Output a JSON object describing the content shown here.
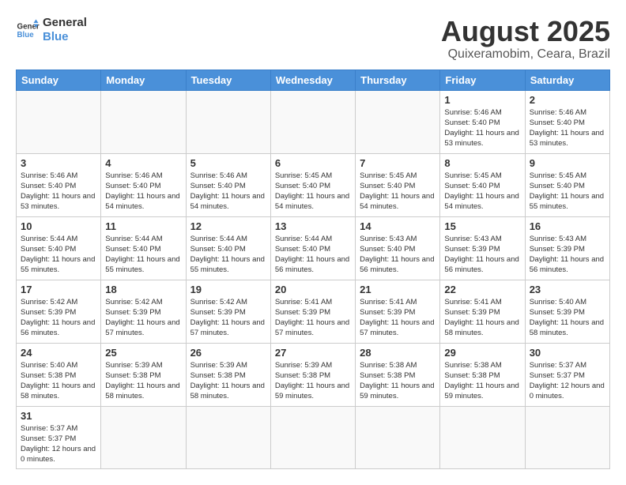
{
  "header": {
    "logo_line1": "General",
    "logo_line2": "Blue",
    "title": "August 2025",
    "subtitle": "Quixeramobim, Ceara, Brazil"
  },
  "days_of_week": [
    "Sunday",
    "Monday",
    "Tuesday",
    "Wednesday",
    "Thursday",
    "Friday",
    "Saturday"
  ],
  "weeks": [
    [
      {
        "day": "",
        "info": ""
      },
      {
        "day": "",
        "info": ""
      },
      {
        "day": "",
        "info": ""
      },
      {
        "day": "",
        "info": ""
      },
      {
        "day": "",
        "info": ""
      },
      {
        "day": "1",
        "info": "Sunrise: 5:46 AM\nSunset: 5:40 PM\nDaylight: 11 hours\nand 53 minutes."
      },
      {
        "day": "2",
        "info": "Sunrise: 5:46 AM\nSunset: 5:40 PM\nDaylight: 11 hours\nand 53 minutes."
      }
    ],
    [
      {
        "day": "3",
        "info": "Sunrise: 5:46 AM\nSunset: 5:40 PM\nDaylight: 11 hours\nand 53 minutes."
      },
      {
        "day": "4",
        "info": "Sunrise: 5:46 AM\nSunset: 5:40 PM\nDaylight: 11 hours\nand 54 minutes."
      },
      {
        "day": "5",
        "info": "Sunrise: 5:46 AM\nSunset: 5:40 PM\nDaylight: 11 hours\nand 54 minutes."
      },
      {
        "day": "6",
        "info": "Sunrise: 5:45 AM\nSunset: 5:40 PM\nDaylight: 11 hours\nand 54 minutes."
      },
      {
        "day": "7",
        "info": "Sunrise: 5:45 AM\nSunset: 5:40 PM\nDaylight: 11 hours\nand 54 minutes."
      },
      {
        "day": "8",
        "info": "Sunrise: 5:45 AM\nSunset: 5:40 PM\nDaylight: 11 hours\nand 54 minutes."
      },
      {
        "day": "9",
        "info": "Sunrise: 5:45 AM\nSunset: 5:40 PM\nDaylight: 11 hours\nand 55 minutes."
      }
    ],
    [
      {
        "day": "10",
        "info": "Sunrise: 5:44 AM\nSunset: 5:40 PM\nDaylight: 11 hours\nand 55 minutes."
      },
      {
        "day": "11",
        "info": "Sunrise: 5:44 AM\nSunset: 5:40 PM\nDaylight: 11 hours\nand 55 minutes."
      },
      {
        "day": "12",
        "info": "Sunrise: 5:44 AM\nSunset: 5:40 PM\nDaylight: 11 hours\nand 55 minutes."
      },
      {
        "day": "13",
        "info": "Sunrise: 5:44 AM\nSunset: 5:40 PM\nDaylight: 11 hours\nand 56 minutes."
      },
      {
        "day": "14",
        "info": "Sunrise: 5:43 AM\nSunset: 5:40 PM\nDaylight: 11 hours\nand 56 minutes."
      },
      {
        "day": "15",
        "info": "Sunrise: 5:43 AM\nSunset: 5:39 PM\nDaylight: 11 hours\nand 56 minutes."
      },
      {
        "day": "16",
        "info": "Sunrise: 5:43 AM\nSunset: 5:39 PM\nDaylight: 11 hours\nand 56 minutes."
      }
    ],
    [
      {
        "day": "17",
        "info": "Sunrise: 5:42 AM\nSunset: 5:39 PM\nDaylight: 11 hours\nand 56 minutes."
      },
      {
        "day": "18",
        "info": "Sunrise: 5:42 AM\nSunset: 5:39 PM\nDaylight: 11 hours\nand 57 minutes."
      },
      {
        "day": "19",
        "info": "Sunrise: 5:42 AM\nSunset: 5:39 PM\nDaylight: 11 hours\nand 57 minutes."
      },
      {
        "day": "20",
        "info": "Sunrise: 5:41 AM\nSunset: 5:39 PM\nDaylight: 11 hours\nand 57 minutes."
      },
      {
        "day": "21",
        "info": "Sunrise: 5:41 AM\nSunset: 5:39 PM\nDaylight: 11 hours\nand 57 minutes."
      },
      {
        "day": "22",
        "info": "Sunrise: 5:41 AM\nSunset: 5:39 PM\nDaylight: 11 hours\nand 58 minutes."
      },
      {
        "day": "23",
        "info": "Sunrise: 5:40 AM\nSunset: 5:39 PM\nDaylight: 11 hours\nand 58 minutes."
      }
    ],
    [
      {
        "day": "24",
        "info": "Sunrise: 5:40 AM\nSunset: 5:38 PM\nDaylight: 11 hours\nand 58 minutes."
      },
      {
        "day": "25",
        "info": "Sunrise: 5:39 AM\nSunset: 5:38 PM\nDaylight: 11 hours\nand 58 minutes."
      },
      {
        "day": "26",
        "info": "Sunrise: 5:39 AM\nSunset: 5:38 PM\nDaylight: 11 hours\nand 58 minutes."
      },
      {
        "day": "27",
        "info": "Sunrise: 5:39 AM\nSunset: 5:38 PM\nDaylight: 11 hours\nand 59 minutes."
      },
      {
        "day": "28",
        "info": "Sunrise: 5:38 AM\nSunset: 5:38 PM\nDaylight: 11 hours\nand 59 minutes."
      },
      {
        "day": "29",
        "info": "Sunrise: 5:38 AM\nSunset: 5:38 PM\nDaylight: 11 hours\nand 59 minutes."
      },
      {
        "day": "30",
        "info": "Sunrise: 5:37 AM\nSunset: 5:37 PM\nDaylight: 12 hours\nand 0 minutes."
      }
    ],
    [
      {
        "day": "31",
        "info": "Sunrise: 5:37 AM\nSunset: 5:37 PM\nDaylight: 12 hours\nand 0 minutes."
      },
      {
        "day": "",
        "info": ""
      },
      {
        "day": "",
        "info": ""
      },
      {
        "day": "",
        "info": ""
      },
      {
        "day": "",
        "info": ""
      },
      {
        "day": "",
        "info": ""
      },
      {
        "day": "",
        "info": ""
      }
    ]
  ]
}
